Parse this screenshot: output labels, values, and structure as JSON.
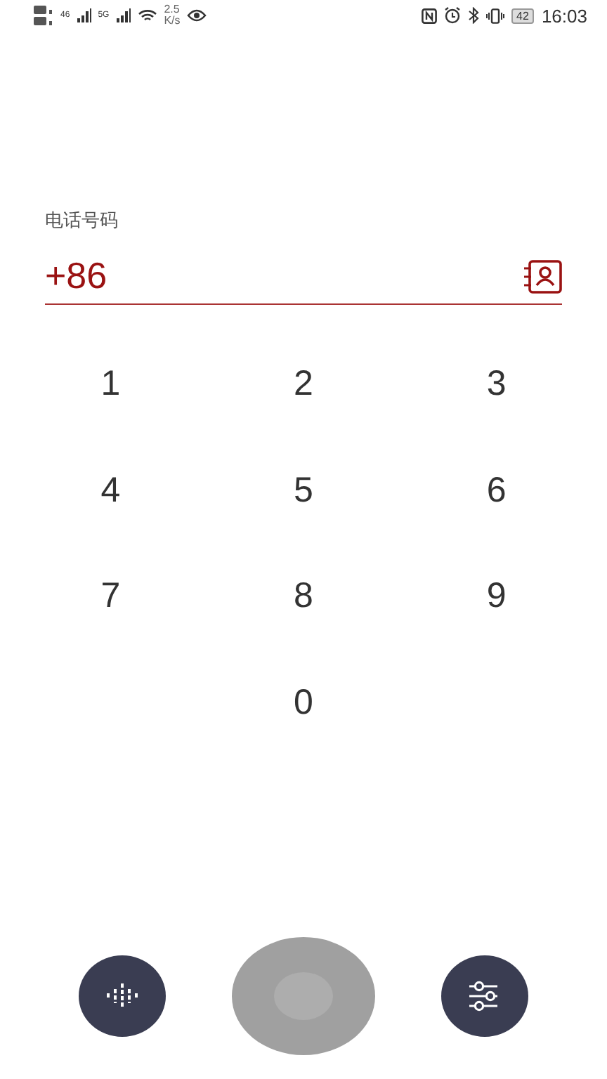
{
  "status_bar": {
    "network_1": "46",
    "network_2": "5G",
    "speed_value": "2.5",
    "speed_unit": "K/s",
    "battery": "42",
    "time": "16:03"
  },
  "phone_field": {
    "label": "电话号码",
    "value": "+86"
  },
  "keypad": [
    [
      "1",
      "2",
      "3"
    ],
    [
      "4",
      "5",
      "6"
    ],
    [
      "7",
      "8",
      "9"
    ],
    [
      "0"
    ]
  ]
}
